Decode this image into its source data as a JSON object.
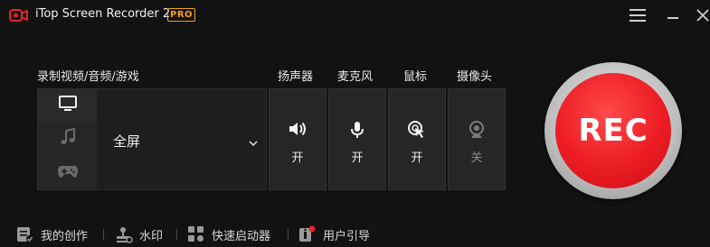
{
  "app": {
    "title": "iTop Screen Recorder 2",
    "badge": "PRO"
  },
  "window_controls": {
    "menu": "menu-icon",
    "minimize": "minimize-icon",
    "close": "close-icon"
  },
  "sections": {
    "capture_label": "录制视频/音频/游戏",
    "speaker_label": "扬声器",
    "mic_label": "麦克风",
    "mouse_label": "鼠标",
    "camera_label": "摄像头"
  },
  "capture": {
    "modes": [
      {
        "icon": "monitor-icon",
        "active": true
      },
      {
        "icon": "music-note-icon",
        "active": false
      },
      {
        "icon": "gamepad-icon",
        "active": false
      }
    ],
    "region": "全屏"
  },
  "devices": {
    "speaker": {
      "state": "开",
      "on": true
    },
    "mic": {
      "state": "开",
      "on": true
    },
    "mouse": {
      "state": "开",
      "on": true
    },
    "camera": {
      "state": "关",
      "on": false
    }
  },
  "rec_button": {
    "label": "REC"
  },
  "footer": {
    "items": [
      {
        "label": "我的创作",
        "icon": "my-creations-icon"
      },
      {
        "label": "水印",
        "icon": "watermark-icon"
      },
      {
        "label": "快速启动器",
        "icon": "quick-launcher-icon"
      },
      {
        "label": "用户引导",
        "icon": "user-guide-icon"
      }
    ]
  },
  "colors": {
    "background": "#121212",
    "rec_red": "#ed1c24",
    "pro_badge": "#f0a21a",
    "notification_dot": "#e8232a"
  }
}
